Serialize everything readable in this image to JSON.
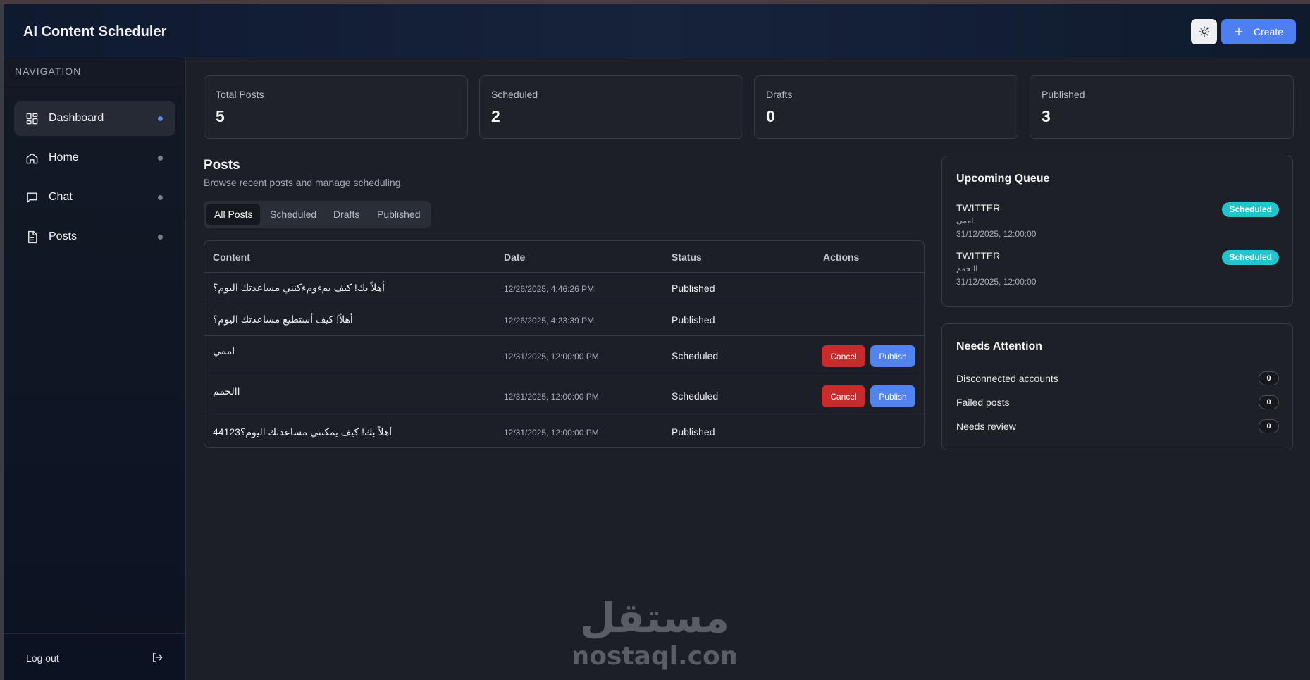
{
  "header": {
    "title": "AI Content Scheduler",
    "theme_icon": "sun-icon",
    "create_label": "Create",
    "create_icon": "plus-icon"
  },
  "sidebar": {
    "heading": "NAVIGATION",
    "items": [
      {
        "label": "Dashboard",
        "icon": "dashboard-grid-icon",
        "active": true
      },
      {
        "label": "Home",
        "icon": "home-icon",
        "active": false
      },
      {
        "label": "Chat",
        "icon": "chat-bubble-icon",
        "active": false
      },
      {
        "label": "Posts",
        "icon": "document-icon",
        "active": false
      }
    ],
    "logout_label": "Log out",
    "logout_icon": "logout-icon"
  },
  "stats": [
    {
      "label": "Total Posts",
      "value": "5"
    },
    {
      "label": "Scheduled",
      "value": "2"
    },
    {
      "label": "Drafts",
      "value": "0"
    },
    {
      "label": "Published",
      "value": "3"
    }
  ],
  "posts": {
    "title": "Posts",
    "subtitle": "Browse recent posts and manage scheduling.",
    "tabs": [
      "All Posts",
      "Scheduled",
      "Drafts",
      "Published"
    ],
    "active_tab": "All Posts",
    "columns": [
      "Content",
      "Date",
      "Status",
      "Actions"
    ],
    "rows": [
      {
        "content": "أهلاً بك! كيف يمءومءكنني مساعدتك اليوم؟",
        "date": "12/26/2025, 4:46:26 PM",
        "status": "Published",
        "actions": []
      },
      {
        "content": "أهلاً! كيف أستطيع مساعدتك اليوم؟",
        "date": "12/26/2025, 4:23:39 PM",
        "status": "Published",
        "actions": []
      },
      {
        "content": "اممي",
        "date": "12/31/2025, 12:00:00 PM",
        "status": "Scheduled",
        "actions": [
          "Cancel",
          "Publish"
        ]
      },
      {
        "content": "االحمم",
        "date": "12/31/2025, 12:00:00 PM",
        "status": "Scheduled",
        "actions": [
          "Cancel",
          "Publish"
        ]
      },
      {
        "content": "أهلاً بك! كيف يمكنني مساعدتك اليوم؟44123",
        "date": "12/31/2025, 12:00:00 PM",
        "status": "Published",
        "actions": []
      }
    ]
  },
  "queue": {
    "title": "Upcoming Queue",
    "items": [
      {
        "platform": "TWITTER",
        "text": "اممي",
        "time": "31/12/2025, 12:00:00",
        "badge": "Scheduled"
      },
      {
        "platform": "TWITTER",
        "text": "االحمم",
        "time": "31/12/2025, 12:00:00",
        "badge": "Scheduled"
      }
    ]
  },
  "attention": {
    "title": "Needs Attention",
    "items": [
      {
        "label": "Disconnected accounts",
        "count": "0"
      },
      {
        "label": "Failed posts",
        "count": "0"
      },
      {
        "label": "Needs review",
        "count": "0"
      }
    ]
  },
  "watermark": {
    "arabic": "مستقل",
    "latin": "mostaql.com"
  },
  "colors": {
    "accent": "#4f7ef0",
    "danger": "#c82b2b",
    "badge": "#22c4cf",
    "background": "#1c1f27"
  }
}
